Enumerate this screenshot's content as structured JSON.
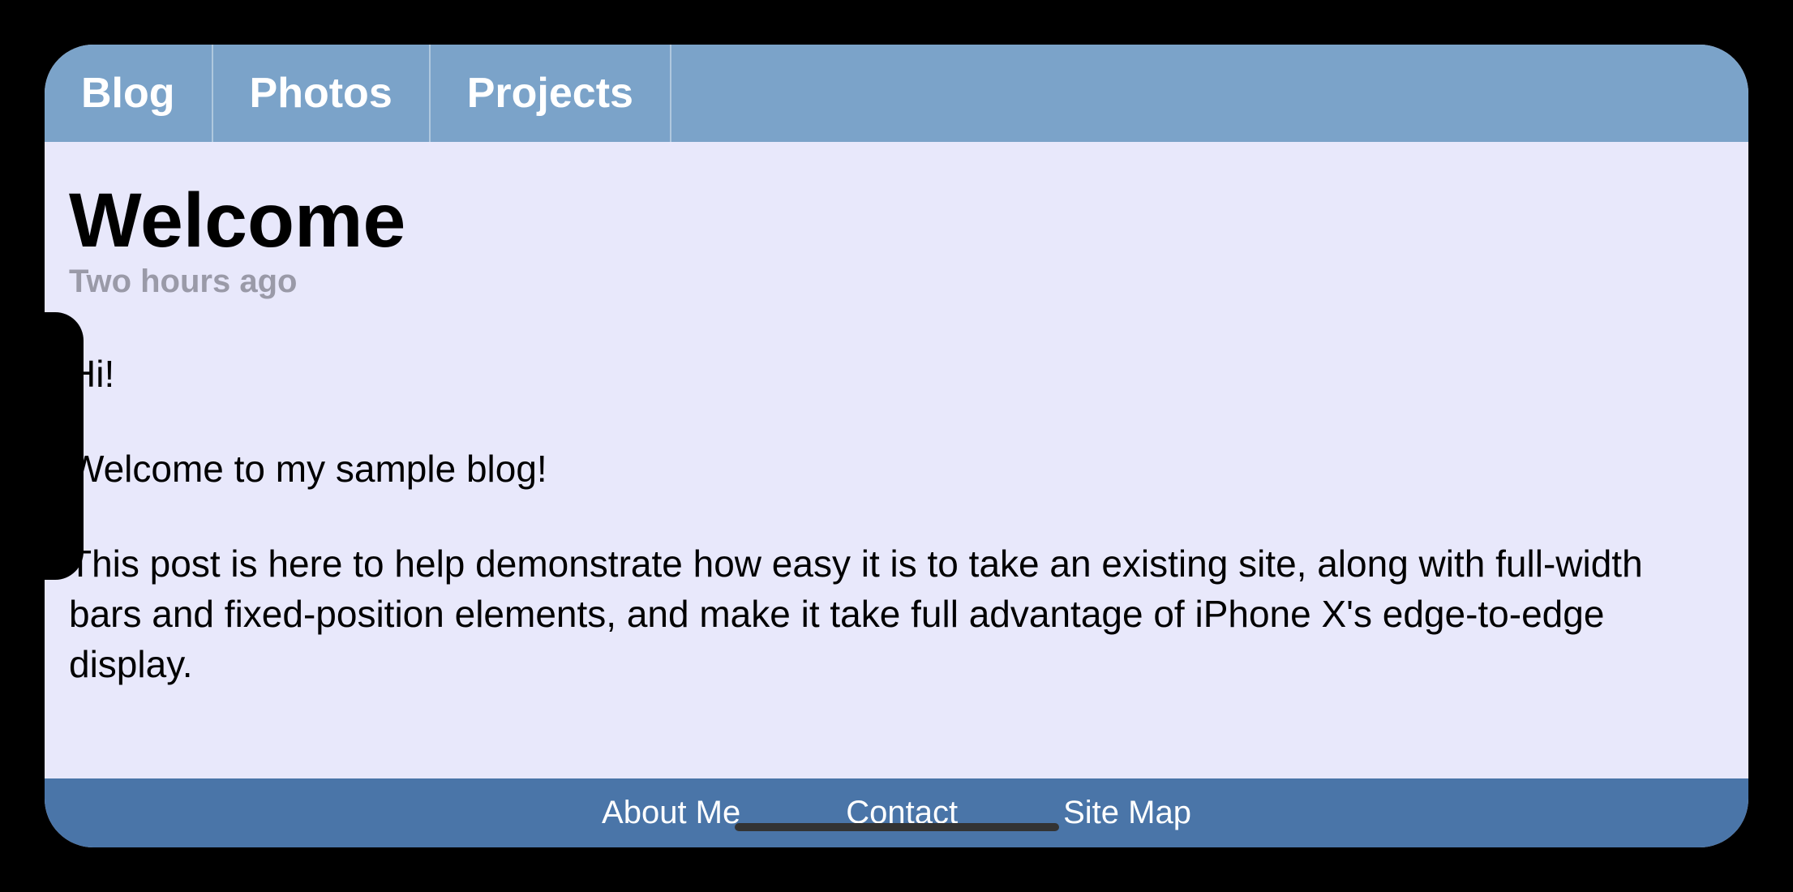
{
  "nav": {
    "items": [
      {
        "label": "Blog"
      },
      {
        "label": "Photos"
      },
      {
        "label": "Projects"
      }
    ]
  },
  "post": {
    "title": "Welcome",
    "meta": "Two hours ago",
    "paragraphs": [
      "Hi!",
      "Welcome to my sample blog!",
      "This post is here to help demonstrate how easy it is to take an existing site, along with full-width bars and fixed-position elements, and make it take full advantage of iPhone X's edge-to-edge display."
    ]
  },
  "footer": {
    "links": [
      {
        "label": "About Me"
      },
      {
        "label": "Contact"
      },
      {
        "label": "Site Map"
      }
    ]
  }
}
